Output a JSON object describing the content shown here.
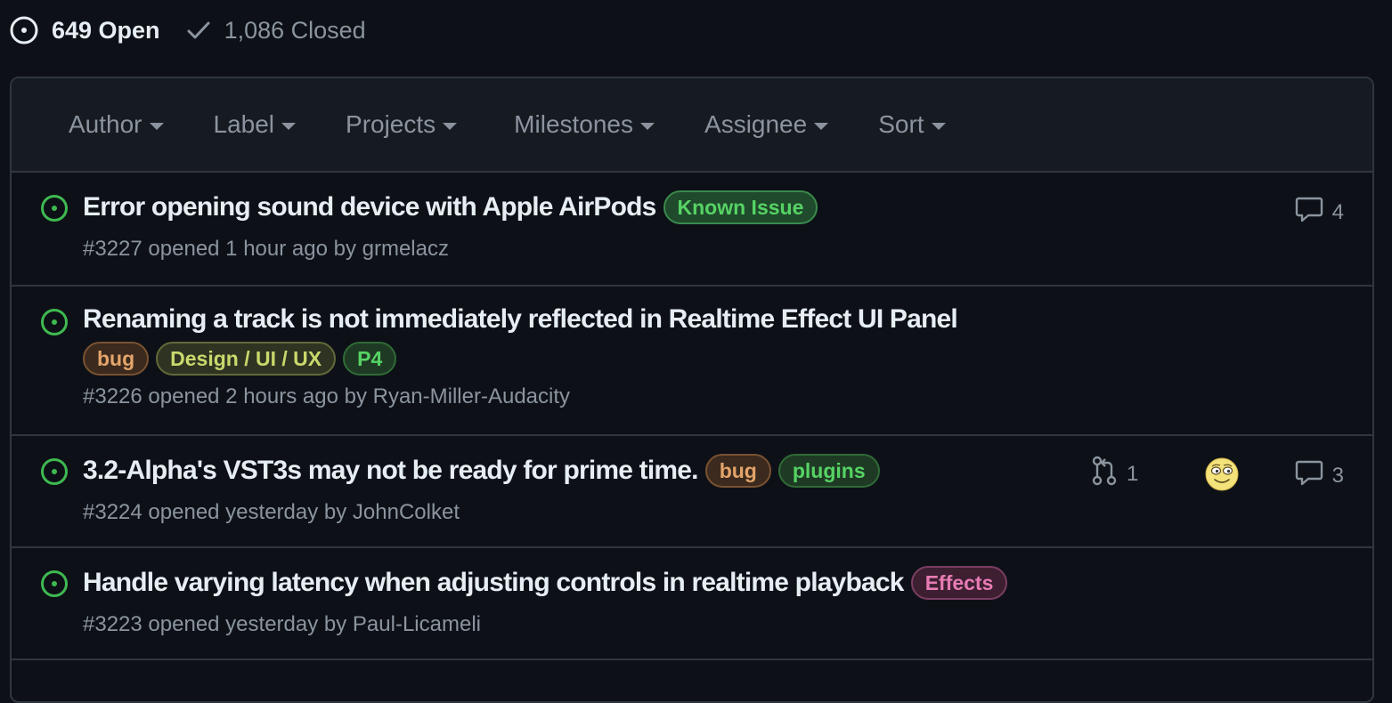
{
  "states": {
    "open_label": "649 Open",
    "closed_label": "1,086 Closed"
  },
  "filters": [
    {
      "label": "Author"
    },
    {
      "label": "Label"
    },
    {
      "label": "Projects"
    },
    {
      "label": "Milestones"
    },
    {
      "label": "Assignee"
    },
    {
      "label": "Sort"
    }
  ],
  "issues": [
    {
      "title": "Error opening sound device with Apple AirPods",
      "labels": [
        {
          "name": "Known Issue",
          "color": "#56d364",
          "bg": "#1f4a2c",
          "border": "#3a8a4c"
        }
      ],
      "number": "#3227",
      "opened_text": "opened 1 hour ago by",
      "author": "grmelacz",
      "comments": "4"
    },
    {
      "title": "Renaming a track is not immediately reflected in Realtime Effect UI Panel",
      "labels": [
        {
          "name": "bug",
          "color": "#e3a46b",
          "bg": "#3b2a1d",
          "border": "#7a5232"
        },
        {
          "name": "Design / UI / UX",
          "color": "#c9d86b",
          "bg": "#2f3422",
          "border": "#62693a"
        },
        {
          "name": "P4",
          "color": "#56d364",
          "bg": "#1f3a24",
          "border": "#2f6b36"
        }
      ],
      "number": "#3226",
      "opened_text": "opened 2 hours ago by",
      "author": "Ryan-Miller-Audacity"
    },
    {
      "title": "3.2-Alpha's VST3s may not be ready for prime time.",
      "labels": [
        {
          "name": "bug",
          "color": "#e3a46b",
          "bg": "#3b2a1d",
          "border": "#7a5232"
        },
        {
          "name": "plugins",
          "color": "#56d364",
          "bg": "#1f3a24",
          "border": "#2f6b36"
        }
      ],
      "number": "#3224",
      "opened_text": "opened yesterday by",
      "author": "JohnColket",
      "linked_prs": "1",
      "comments": "3",
      "assignee_avatar": "smiley-face"
    },
    {
      "title": "Handle varying latency when adjusting controls in realtime playback",
      "labels": [
        {
          "name": "Effects",
          "color": "#e87bb4",
          "bg": "#3d1f31",
          "border": "#7c3d63"
        }
      ],
      "number": "#3223",
      "opened_text": "opened yesterday by",
      "author": "Paul-Licameli"
    }
  ]
}
